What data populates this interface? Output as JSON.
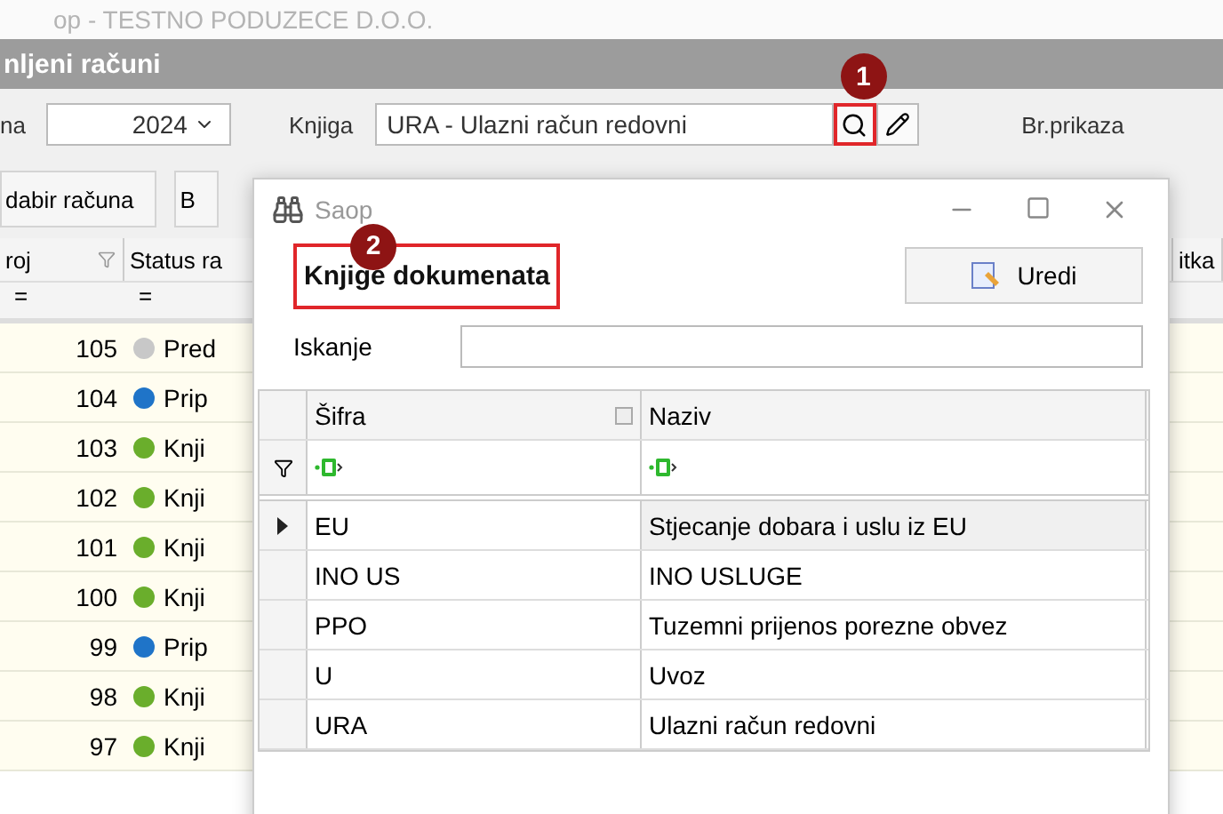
{
  "app_title": "op - TESTNO PODUZECE D.O.O.",
  "module_title": "nljeni računi",
  "toolbar": {
    "year_label": "na",
    "year": "2024",
    "book_label": "Knjiga",
    "book_value": "URA - Ulazni račun redovni",
    "search_callout": "1",
    "count_label": "Br.prikaza"
  },
  "buttons": [
    "dabir računa",
    "B"
  ],
  "grid": {
    "columns": [
      "roj",
      "Status ra",
      "itka"
    ],
    "filter_marks": [
      "=",
      "="
    ],
    "rows": [
      {
        "number": "105",
        "status": "Pred",
        "color": "#c8c8c8"
      },
      {
        "number": "104",
        "status": "Prip",
        "color": "#1f74c8"
      },
      {
        "number": "103",
        "status": "Knji",
        "color": "#6aae2c"
      },
      {
        "number": "102",
        "status": "Knji",
        "color": "#6aae2c"
      },
      {
        "number": "101",
        "status": "Knji",
        "color": "#6aae2c"
      },
      {
        "number": "100",
        "status": "Knji",
        "color": "#6aae2c"
      },
      {
        "number": "99",
        "status": "Prip",
        "color": "#1f74c8"
      },
      {
        "number": "98",
        "status": "Knji",
        "color": "#6aae2c"
      },
      {
        "number": "97",
        "status": "Knji",
        "color": "#6aae2c"
      }
    ]
  },
  "dialog": {
    "title": "Saop",
    "heading": "Knjige dokumenata",
    "heading_callout": "2",
    "edit_button": "Uredi",
    "search_label": "Iskanje",
    "columns": [
      "Šifra",
      "Naziv"
    ],
    "rows": [
      {
        "code": "EU",
        "name": "Stjecanje dobara i uslu iz EU",
        "selected": true
      },
      {
        "code": "INO US",
        "name": "INO USLUGE",
        "selected": false
      },
      {
        "code": "PPO",
        "name": "Tuzemni prijenos porezne obvez",
        "selected": false
      },
      {
        "code": "U",
        "name": "Uvoz",
        "selected": false
      },
      {
        "code": "URA",
        "name": "Ulazni račun redovni",
        "selected": false
      }
    ]
  }
}
